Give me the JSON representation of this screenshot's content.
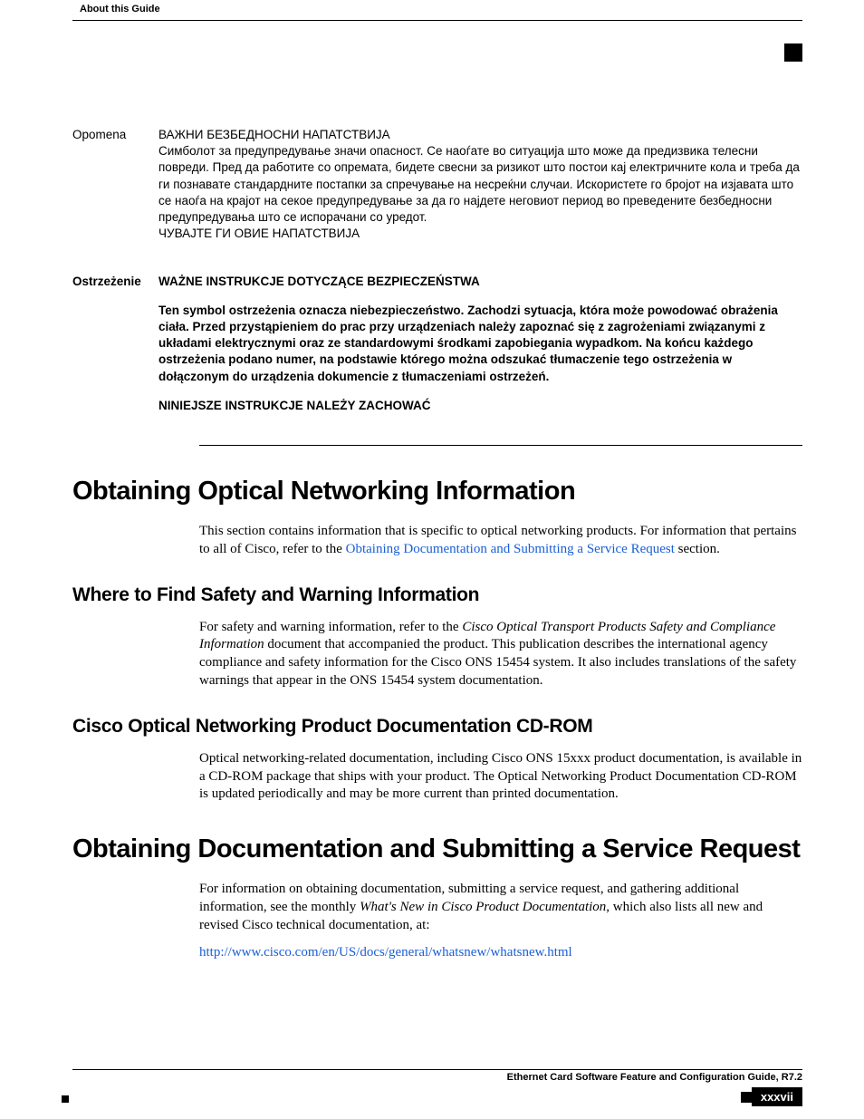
{
  "header": {
    "running_head": "About this Guide"
  },
  "warnings": [
    {
      "label": "Opomena",
      "label_bold": false,
      "body_bold": false,
      "title": "ВАЖНИ БЕЗБЕДНОСНИ НАПАТСТВИЈА",
      "text": "Симболот за предупредување значи опасност. Се наоѓате во ситуација што може да предизвика телесни повреди. Пред да работите со опремата, бидете свесни за ризикот што постои кај електричните кола и треба да ги познавате стандардните постапки за спречување на несреќни случаи. Искористете го бројот на изјавата што се наоѓа на крајот на секое предупредување за да го најдете неговиот период во преведените безбедносни предупредувања што се испорачани со уредот.",
      "footer": "ЧУВАЈТЕ ГИ ОВИЕ НАПАТСТВИЈА"
    },
    {
      "label": "Ostrzeżenie",
      "label_bold": true,
      "body_bold": true,
      "title": "WAŻNE INSTRUKCJE DOTYCZĄCE BEZPIECZEŃSTWA",
      "text": "Ten symbol ostrzeżenia oznacza niebezpieczeństwo. Zachodzi sytuacja, która może powodować obrażenia ciała. Przed przystąpieniem do prac przy urządzeniach należy zapoznać się z zagrożeniami związanymi z układami elektrycznymi oraz ze standardowymi środkami zapobiegania wypadkom. Na końcu każdego ostrzeżenia podano numer, na podstawie którego można odszukać tłumaczenie tego ostrzeżenia w dołączonym do urządzenia dokumencie z tłumaczeniami ostrzeżeń.",
      "footer": "NINIEJSZE INSTRUKCJE NALEŻY ZACHOWAĆ"
    }
  ],
  "sections": {
    "h1a": "Obtaining Optical Networking Information",
    "p1_pre": "This section contains information that is specific to optical networking products. For information that pertains to all of Cisco, refer to the ",
    "p1_link": "Obtaining Documentation and Submitting a Service Request",
    "p1_post": " section.",
    "h2a": "Where to Find Safety and Warning Information",
    "p2_pre": "For safety and warning information, refer to the ",
    "p2_italic": "Cisco Optical Transport Products Safety and Compliance Information",
    "p2_post": " document that accompanied the product. This publication describes the international agency compliance and safety information for the Cisco ONS 15454 system. It also includes translations of the safety warnings that appear in the ONS 15454 system documentation.",
    "h2b": "Cisco Optical Networking Product Documentation CD-ROM",
    "p3": "Optical networking-related documentation, including Cisco ONS 15xxx product documentation, is available in a CD-ROM package that ships with your product. The Optical Networking Product Documentation CD-ROM is updated periodically and may be more current than printed documentation.",
    "h1b": "Obtaining Documentation and Submitting a Service Request",
    "p4_pre": "For information on obtaining documentation, submitting a service request, and gathering additional information, see the monthly ",
    "p4_italic": "What's New in Cisco Product Documentation",
    "p4_post": ", which also lists all new and revised Cisco technical documentation, at:",
    "p5_link": "http://www.cisco.com/en/US/docs/general/whatsnew/whatsnew.html"
  },
  "footer": {
    "doc_title": "Ethernet Card Software Feature and Configuration Guide, R7.2",
    "page_number": "xxxvii"
  }
}
